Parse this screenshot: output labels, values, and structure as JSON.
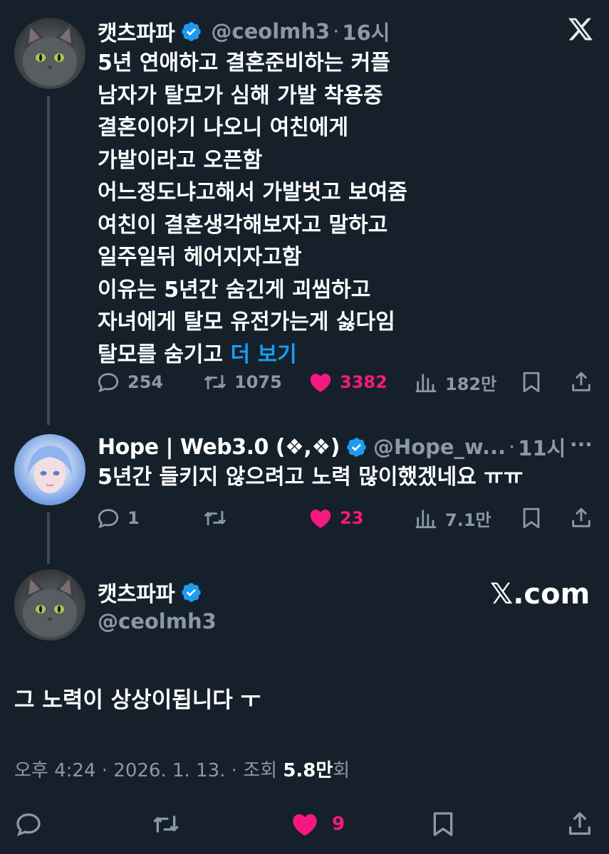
{
  "post1": {
    "display_name": "캣츠파파",
    "handle": "@ceolmh3",
    "separator": "·",
    "time": "16시",
    "lines": [
      "5년 연애하고 결혼준비하는 커플",
      "남자가 탈모가 심해 가발 착용중",
      "결혼이야기 나오니 여친에게",
      "가발이라고 오픈함",
      "어느정도냐고해서 가발벗고 보여줌",
      "여친이 결혼생각해보자고 말하고",
      "일주일뒤 헤어지자고함",
      "이유는 5년간 숨긴게 괴씸하고",
      "자녀에게 탈모 유전가는게 싫다임"
    ],
    "last_line": "탈모를 숨기고",
    "more_label": "더 보기",
    "replies": "254",
    "retweets": "1075",
    "likes": "3382",
    "views": "182만",
    "icons": {
      "x": "x-logo-icon",
      "badge": "verified-badge-icon"
    }
  },
  "post2": {
    "display_name": "Hope | Web3.0 (❖,❖)",
    "handle": "@Hope_w...",
    "separator": "·",
    "time": "11시",
    "more_icon": "···",
    "text": "5년간 들키지 않으려고 노력 많이했겠네요 ㅠㅠ",
    "replies": "1",
    "likes": "23",
    "views": "7.1만"
  },
  "post3": {
    "display_name": "캣츠파파",
    "handle": "@ceolmh3",
    "watermark": "𝕏.com",
    "text": "그 노력이 상상이됩니다 ㅜ",
    "meta_prefix": "오후 4:24 · 2026. 1. 13. · 조회",
    "views_value": "5.8만",
    "views_suffix": "회",
    "likes": "9"
  },
  "colors": {
    "background": "#15202b",
    "muted": "#8b98a5",
    "link": "#1d9bf0",
    "like": "#f91880",
    "verified": "#1d9bf0"
  }
}
